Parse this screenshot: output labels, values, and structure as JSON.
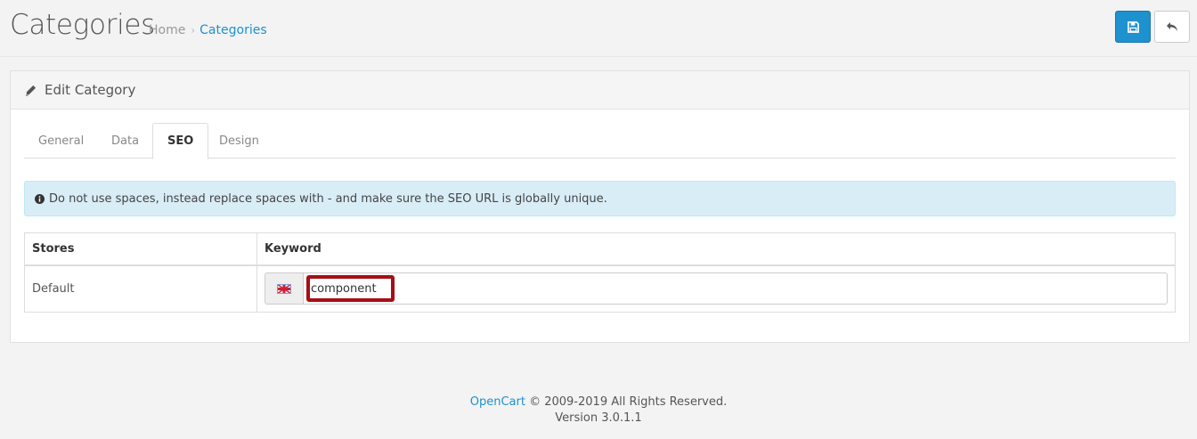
{
  "header": {
    "title": "Categories",
    "breadcrumb": [
      {
        "label": "Home"
      },
      {
        "label": "Categories"
      }
    ],
    "breadcrumb_separator": "›"
  },
  "panel": {
    "heading": "Edit Category"
  },
  "tabs": [
    {
      "label": "General",
      "active": false
    },
    {
      "label": "Data",
      "active": false
    },
    {
      "label": "SEO",
      "active": true
    },
    {
      "label": "Design",
      "active": false
    }
  ],
  "alert": {
    "text": "Do not use spaces, instead replace spaces with - and make sure the SEO URL is globally unique."
  },
  "seo_table": {
    "headers": [
      "Stores",
      "Keyword"
    ],
    "rows": [
      {
        "store": "Default",
        "keyword": "component"
      }
    ]
  },
  "footer": {
    "brand": "OpenCart",
    "copyright": "© 2009-2019 All Rights Reserved.",
    "version": "Version 3.0.1.1"
  },
  "colors": {
    "primary": "#1e91cf",
    "highlight": "#a50e16",
    "alert_bg": "#d9edf7"
  },
  "icons": [
    "save-icon",
    "reply-icon",
    "pencil-icon",
    "info-circle-icon",
    "uk-flag-icon"
  ]
}
